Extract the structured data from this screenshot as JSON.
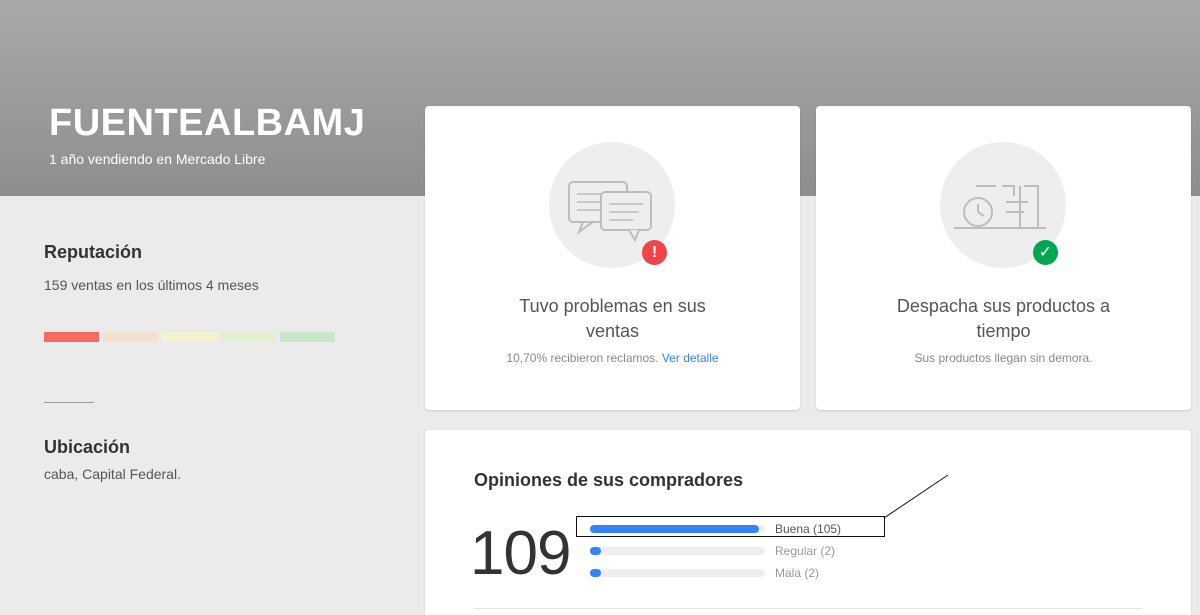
{
  "colors": {
    "accent": "#3483fa",
    "thermometer": [
      "#f96b5e",
      "#f4e0cf",
      "#f5f2d0",
      "#e3f0d0",
      "#c8e6c9"
    ],
    "badge_warning": "#f04449",
    "badge_success": "#00a650"
  },
  "seller": {
    "name": "FUENTEALBAMJ",
    "since": "1 año vendiendo en Mercado Libre"
  },
  "reputation": {
    "title": "Reputación",
    "sales": "159 ventas en los últimos 4 meses",
    "level_segments": 5,
    "active_segment": 1
  },
  "location": {
    "title": "Ubicación",
    "value": "caba, Capital Federal."
  },
  "cards": {
    "claims": {
      "icon": "chat-bubbles-icon",
      "badge_icon": "exclamation-icon",
      "badge": "!",
      "title": "Tuvo problemas en sus ventas",
      "subtitle": "10,70% recibieron reclamos.",
      "link": "Ver detalle"
    },
    "shipping": {
      "icon": "shipping-clock-icon",
      "badge_icon": "check-icon",
      "badge": "✓",
      "title": "Despacha sus productos a tiempo",
      "subtitle": "Sus productos llegan sin demora."
    }
  },
  "opinions": {
    "title": "Opiniones de sus compradores",
    "total": "109",
    "rows": [
      {
        "label": "Buena (105)",
        "count": 105
      },
      {
        "label": "Regular (2)",
        "count": 2
      },
      {
        "label": "Mala (2)",
        "count": 2
      }
    ]
  }
}
